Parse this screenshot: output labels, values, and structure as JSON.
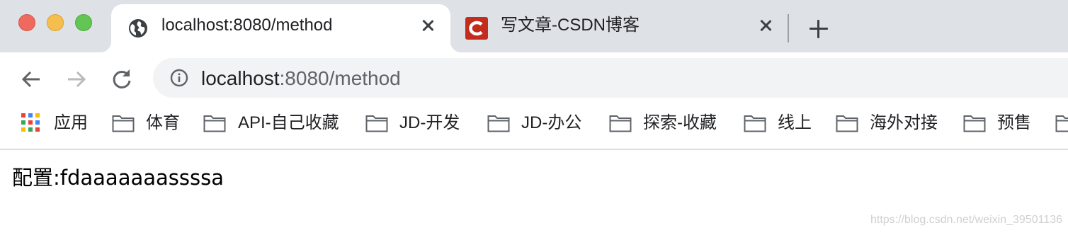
{
  "tabs": [
    {
      "title": "localhost:8080/method",
      "icon": "globe-icon",
      "active": true
    },
    {
      "title": "写文章-CSDN博客",
      "icon": "csdn-logo-icon",
      "active": false
    }
  ],
  "address_bar": {
    "host": "localhost",
    "rest": ":8080/method"
  },
  "bookmarks": {
    "apps_label": "应用",
    "folders": [
      "体育",
      "API-自己收藏",
      "JD-开发",
      "JD-办公",
      "探索-收藏",
      "线上",
      "海外对接",
      "预售"
    ]
  },
  "page": {
    "text": "配置:fdaaaaaaassssa"
  },
  "watermark": "https://blog.csdn.net/weixin_39501136",
  "colors": {
    "tabstrip": "#dee1e6",
    "omnibox": "#f1f3f4",
    "csdn_red": "#c32d1e",
    "traffic_red": "#ee6a5f",
    "traffic_yellow": "#f5be4f",
    "traffic_green": "#62c554"
  }
}
